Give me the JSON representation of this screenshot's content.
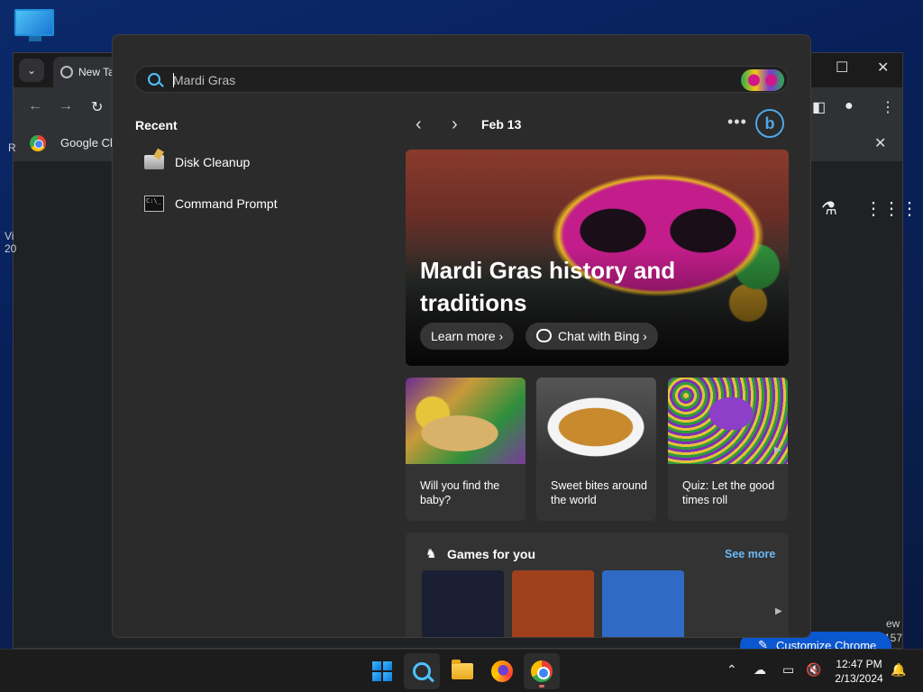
{
  "chrome": {
    "tab_title": "New Ta",
    "bookmark_label": "Google Ch",
    "edge_left_1": "R",
    "edge_left_2": "Vi",
    "edge_left_3": "20",
    "edge_right_1": "ew",
    "edge_right_2": "157",
    "customize_label": "Customize Chrome"
  },
  "search": {
    "value": "Mardi Gras",
    "placeholder": "Mardi Gras"
  },
  "recent": {
    "title": "Recent",
    "items": [
      {
        "label": "Disk Cleanup"
      },
      {
        "label": "Command Prompt"
      }
    ]
  },
  "highlights": {
    "date": "Feb 13",
    "hero": {
      "title": "Mardi Gras history and traditions",
      "learn_more": "Learn more",
      "chat": "Chat with Bing"
    },
    "cards": [
      {
        "caption": "Will you find the baby?"
      },
      {
        "caption": "Sweet bites around the world"
      },
      {
        "caption": "Quiz: Let the good times roll"
      }
    ],
    "games": {
      "title": "Games for you",
      "see_more": "See more",
      "tile_colors": [
        "#1a1f33",
        "#a0401c",
        "#2f6bc4"
      ]
    }
  },
  "taskbar": {
    "time": "12:47 PM",
    "date": "2/13/2024"
  },
  "colors": {
    "accent": "#4cc2ff",
    "link": "#6cb8f6"
  }
}
